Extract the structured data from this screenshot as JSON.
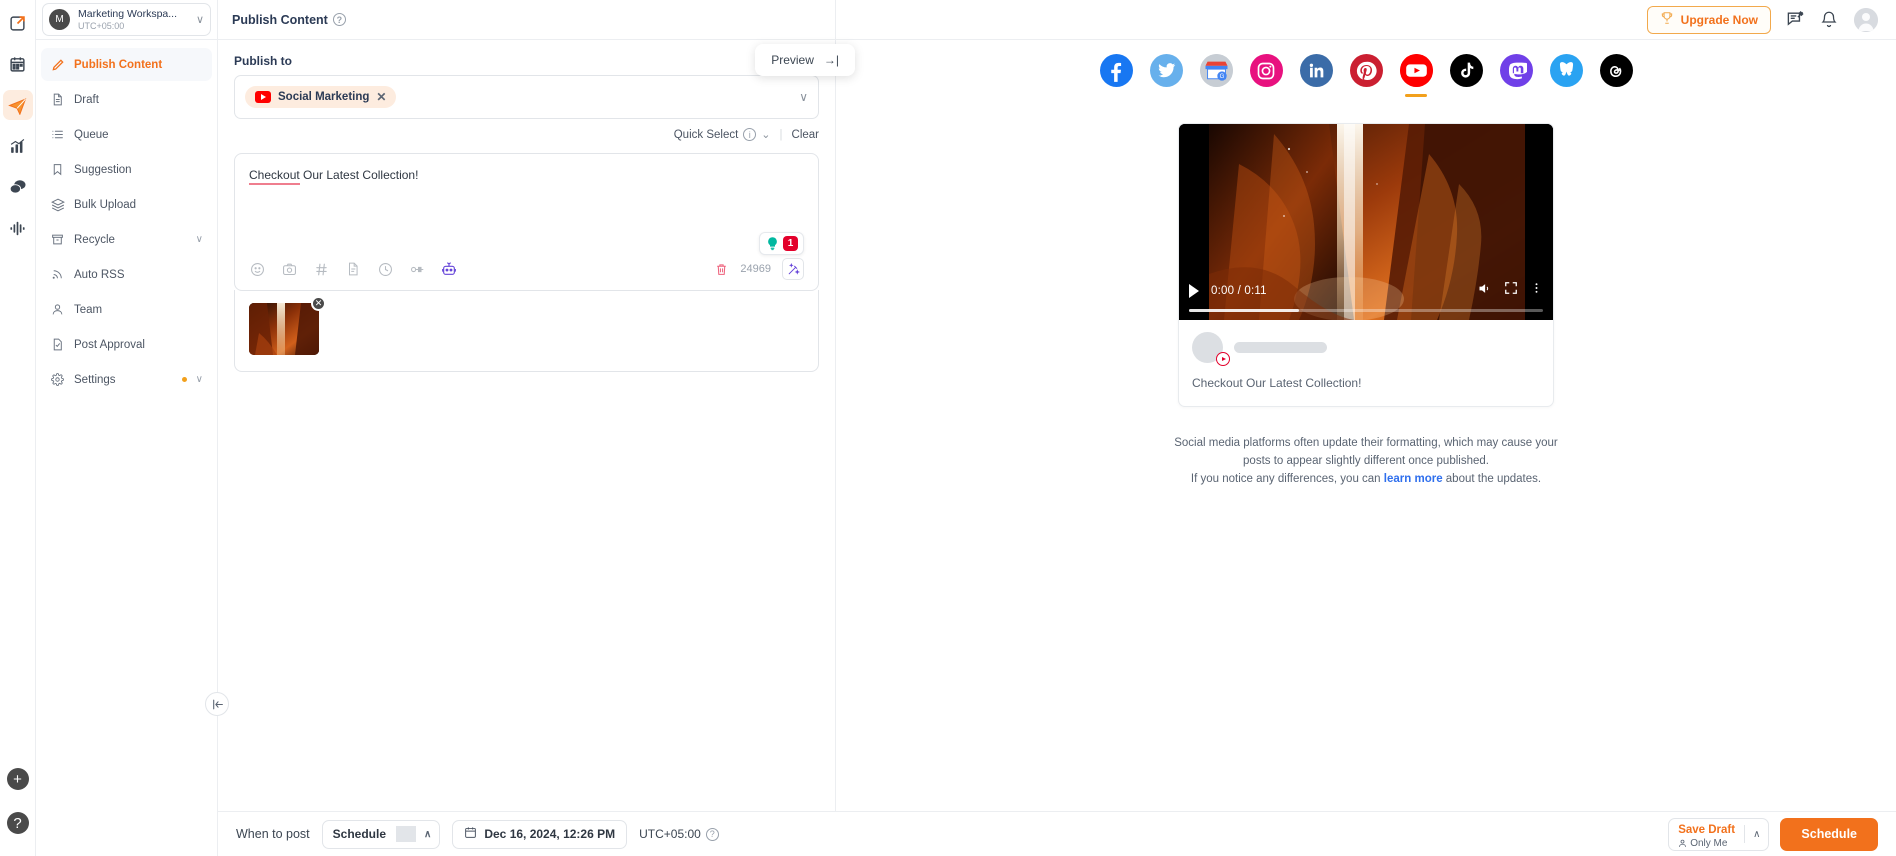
{
  "rail": {
    "items": [
      {
        "name": "compose-icon",
        "label": "Compose"
      },
      {
        "name": "calendar-icon",
        "label": "Calendar"
      },
      {
        "name": "publish-icon",
        "label": "Publish"
      },
      {
        "name": "analytics-icon",
        "label": "Analytics"
      },
      {
        "name": "inbox-icon",
        "label": "Inbox"
      },
      {
        "name": "listening-icon",
        "label": "Listening"
      }
    ],
    "add_label": "+",
    "help_label": "?"
  },
  "workspace": {
    "avatar_initial": "M",
    "name": "Marketing Workspa...",
    "timezone": "UTC+05:00",
    "chevron": "∨"
  },
  "sidebar": {
    "items": [
      {
        "label": "Publish Content",
        "icon": "pencil-icon",
        "active": true
      },
      {
        "label": "Draft",
        "icon": "document-icon",
        "active": false
      },
      {
        "label": "Queue",
        "icon": "list-icon",
        "active": false
      },
      {
        "label": "Suggestion",
        "icon": "bookmark-icon",
        "active": false
      },
      {
        "label": "Bulk Upload",
        "icon": "layers-icon",
        "active": false
      },
      {
        "label": "Recycle",
        "icon": "archive-icon",
        "active": false,
        "chevron": "∨"
      },
      {
        "label": "Auto RSS",
        "icon": "rss-icon",
        "active": false
      },
      {
        "label": "Team",
        "icon": "user-icon",
        "active": false
      },
      {
        "label": "Post Approval",
        "icon": "approval-icon",
        "active": false
      },
      {
        "label": "Settings",
        "icon": "gear-icon",
        "active": false,
        "chevron": "∨",
        "dot": true
      }
    ]
  },
  "header": {
    "title": "Publish Content",
    "help": "?",
    "preview_label": "Preview",
    "preview_arrow": "→|"
  },
  "publish": {
    "section_label": "Publish to",
    "chip": {
      "label": "Social Marketing",
      "platform": "youtube",
      "remove": "✕"
    },
    "select_chevron": "∨",
    "quick_select": "Quick Select",
    "quick_select_info": "i",
    "separator": "|",
    "clear": "Clear"
  },
  "editor": {
    "text_misspelled": "Checkout",
    "text_rest": " Our Latest Collection!",
    "full_text": "Checkout Our Latest Collection!",
    "suggestion_count": "1",
    "character_count": "24969",
    "toolbar_icons": [
      "emoji-icon",
      "image-icon",
      "hashtag-icon",
      "template-icon",
      "history-icon",
      "link-icon",
      "ai-bot-icon"
    ],
    "delete_icon": "trash-icon",
    "magic_icon": "magic-wand-icon"
  },
  "media": {
    "remove": "✕"
  },
  "bottom": {
    "when_to_post": "When to post",
    "schedule_mode": "Schedule",
    "schedule_chevron": "∧",
    "date": "Dec 16, 2024, 12:26 PM",
    "timezone": "UTC+05:00",
    "tz_help": "?",
    "save_draft": "Save Draft",
    "save_draft_sub": "Only Me",
    "save_draft_chevron": "∧",
    "submit": "Schedule"
  },
  "topbar": {
    "upgrade": "Upgrade Now",
    "trophy_icon": "trophy-icon",
    "feedback_icon": "feedback-icon",
    "bell_icon": "bell-icon",
    "avatar_icon": "user-avatar"
  },
  "platforms": [
    {
      "name": "facebook",
      "active": false
    },
    {
      "name": "twitter",
      "active": false
    },
    {
      "name": "google-business",
      "active": false
    },
    {
      "name": "instagram",
      "active": false
    },
    {
      "name": "linkedin",
      "active": false
    },
    {
      "name": "pinterest",
      "active": false
    },
    {
      "name": "youtube",
      "active": true
    },
    {
      "name": "tiktok",
      "active": false
    },
    {
      "name": "mastodon",
      "active": false
    },
    {
      "name": "bluesky",
      "active": false
    },
    {
      "name": "threads",
      "active": false
    }
  ],
  "preview": {
    "video_time": "0:00 / 0:11",
    "caption": "Checkout Our Latest Collection!",
    "disclaimer_line1": "Social media platforms often update their formatting, which may cause your",
    "disclaimer_line2": "posts to appear slightly different once published.",
    "disclaimer_line3_pre": "If you notice any differences, you can ",
    "disclaimer_link": "learn more",
    "disclaimer_line3_post": " about the updates."
  },
  "colors": {
    "accent": "#f2711c",
    "danger": "#e3002b",
    "link": "#2f6fed",
    "youtube": "#ff0000"
  }
}
